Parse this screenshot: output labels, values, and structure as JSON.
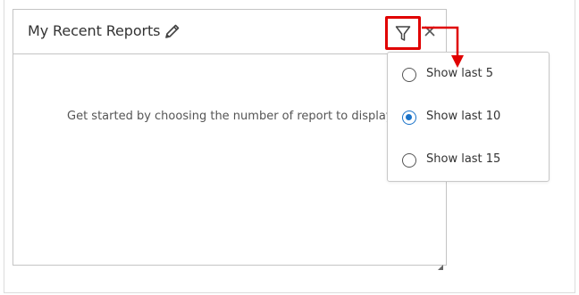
{
  "widget": {
    "title": "My Recent Reports",
    "empty_message": "Get started by choosing the number of report to display"
  },
  "icons": {
    "edit": "pencil-icon",
    "filter": "filter-funnel-icon",
    "close": "close-x-icon",
    "resize": "resize-grip-icon"
  },
  "filter_menu": {
    "options": [
      {
        "label": "Show last 5",
        "selected": false
      },
      {
        "label": "Show last 10",
        "selected": true
      },
      {
        "label": "Show last 15",
        "selected": false
      }
    ]
  },
  "colors": {
    "highlight": "#e00000",
    "radio_selected": "#1a73c9",
    "border": "#c4c4c4"
  }
}
